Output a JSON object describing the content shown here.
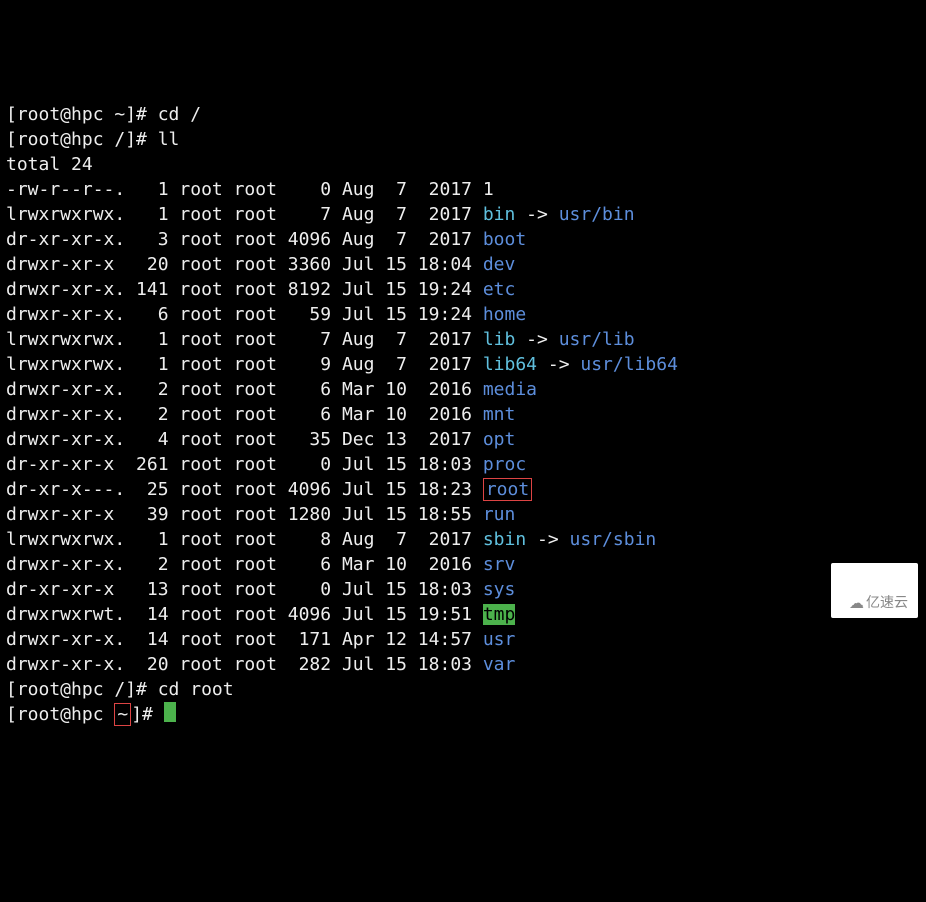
{
  "prompts": {
    "p1_pre": "[root@hpc ",
    "p1_dir": "~",
    "p1_post": "]# ",
    "cmd1": "cd /",
    "p2_pre": "[root@hpc /]# ",
    "cmd2": "ll",
    "total": "total 24",
    "p3_pre": "[root@hpc /]# ",
    "cmd3": "cd root",
    "p4_pre": "[root@hpc ",
    "p4_dir": "~",
    "p4_post": "]# "
  },
  "rows": [
    {
      "perm": "-rw-r--r--.",
      "nl": "  1",
      "ug": "root root",
      "sz": "   0",
      "date": "Aug  7  2017",
      "name": "1",
      "color": "wht"
    },
    {
      "perm": "lrwxrwxrwx.",
      "nl": "  1",
      "ug": "root root",
      "sz": "   7",
      "date": "Aug  7  2017",
      "name": "bin",
      "color": "cyan",
      "arrow": " -> ",
      "target": "usr/bin"
    },
    {
      "perm": "dr-xr-xr-x.",
      "nl": "  3",
      "ug": "root root",
      "sz": "4096",
      "date": "Aug  7  2017",
      "name": "boot",
      "color": "blue"
    },
    {
      "perm": "drwxr-xr-x ",
      "nl": " 20",
      "ug": "root root",
      "sz": "3360",
      "date": "Jul 15 18:04",
      "name": "dev",
      "color": "blue"
    },
    {
      "perm": "drwxr-xr-x.",
      "nl": "141",
      "ug": "root root",
      "sz": "8192",
      "date": "Jul 15 19:24",
      "name": "etc",
      "color": "blue"
    },
    {
      "perm": "drwxr-xr-x.",
      "nl": "  6",
      "ug": "root root",
      "sz": "  59",
      "date": "Jul 15 19:24",
      "name": "home",
      "color": "blue"
    },
    {
      "perm": "lrwxrwxrwx.",
      "nl": "  1",
      "ug": "root root",
      "sz": "   7",
      "date": "Aug  7  2017",
      "name": "lib",
      "color": "cyan",
      "arrow": " -> ",
      "target": "usr/lib"
    },
    {
      "perm": "lrwxrwxrwx.",
      "nl": "  1",
      "ug": "root root",
      "sz": "   9",
      "date": "Aug  7  2017",
      "name": "lib64",
      "color": "cyan",
      "arrow": " -> ",
      "target": "usr/lib64"
    },
    {
      "perm": "drwxr-xr-x.",
      "nl": "  2",
      "ug": "root root",
      "sz": "   6",
      "date": "Mar 10  2016",
      "name": "media",
      "color": "blue"
    },
    {
      "perm": "drwxr-xr-x.",
      "nl": "  2",
      "ug": "root root",
      "sz": "   6",
      "date": "Mar 10  2016",
      "name": "mnt",
      "color": "blue"
    },
    {
      "perm": "drwxr-xr-x.",
      "nl": "  4",
      "ug": "root root",
      "sz": "  35",
      "date": "Dec 13  2017",
      "name": "opt",
      "color": "blue"
    },
    {
      "perm": "dr-xr-xr-x ",
      "nl": "261",
      "ug": "root root",
      "sz": "   0",
      "date": "Jul 15 18:03",
      "name": "proc",
      "color": "blue"
    },
    {
      "perm": "dr-xr-x---.",
      "nl": " 25",
      "ug": "root root",
      "sz": "4096",
      "date": "Jul 15 18:23",
      "name": "root",
      "color": "blue",
      "hl": true
    },
    {
      "perm": "drwxr-xr-x ",
      "nl": " 39",
      "ug": "root root",
      "sz": "1280",
      "date": "Jul 15 18:55",
      "name": "run",
      "color": "blue"
    },
    {
      "perm": "lrwxrwxrwx.",
      "nl": "  1",
      "ug": "root root",
      "sz": "   8",
      "date": "Aug  7  2017",
      "name": "sbin",
      "color": "cyan",
      "arrow": " -> ",
      "target": "usr/sbin"
    },
    {
      "perm": "drwxr-xr-x.",
      "nl": "  2",
      "ug": "root root",
      "sz": "   6",
      "date": "Mar 10  2016",
      "name": "srv",
      "color": "blue"
    },
    {
      "perm": "dr-xr-xr-x ",
      "nl": " 13",
      "ug": "root root",
      "sz": "   0",
      "date": "Jul 15 18:03",
      "name": "sys",
      "color": "blue"
    },
    {
      "perm": "drwxrwxrwt.",
      "nl": " 14",
      "ug": "root root",
      "sz": "4096",
      "date": "Jul 15 19:51",
      "name": "tmp",
      "color": "green-bg"
    },
    {
      "perm": "drwxr-xr-x.",
      "nl": " 14",
      "ug": "root root",
      "sz": " 171",
      "date": "Apr 12 14:57",
      "name": "usr",
      "color": "blue"
    },
    {
      "perm": "drwxr-xr-x.",
      "nl": " 20",
      "ug": "root root",
      "sz": " 282",
      "date": "Jul 15 18:03",
      "name": "var",
      "color": "blue"
    }
  ],
  "watermark": "亿速云"
}
